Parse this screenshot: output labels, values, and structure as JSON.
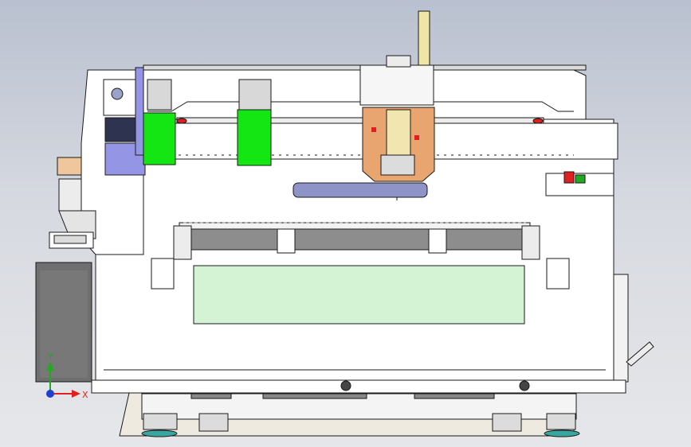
{
  "scene": {
    "background_top": "#b9c0cf",
    "background_bottom": "#e6e7ea",
    "part_colors": {
      "frame": "#ffffff",
      "edge": "#1a1a1a",
      "panel_green": "#d4f2d4",
      "carriage_green": "#14e614",
      "spindle_copper": "#e8a56f",
      "motor_blue": "#9595e6",
      "dark_gray": "#6f6f6f",
      "rail_gray": "#8d8d8d",
      "pipe_blue": "#8f94c8",
      "mast_yellow": "#efe6a6",
      "accent_red": "#e02020"
    }
  },
  "axis_triad": {
    "y_label": "Y",
    "x_label": "X",
    "y_color": "#1faa1f",
    "x_color": "#e02020",
    "origin_color": "#1f3fcf"
  }
}
